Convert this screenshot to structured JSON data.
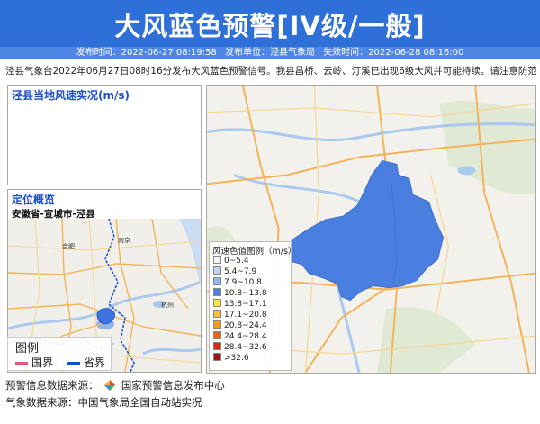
{
  "header": {
    "title": "大风蓝色预警[IV级/一般]",
    "publish_time_label": "发布时间：2022-06-27 08:19:58",
    "publisher_label": "发布单位：泾县气象局",
    "expire_time_label": "失效时间：2022-06-28 08:16:00"
  },
  "notice": "泾县气象台2022年06月27日08时16分发布大风蓝色预警信号。我县昌桥、云岭、汀溪已出现6级大风并可能持续。请注意防范！",
  "wind_panel": {
    "title": "泾县当地风速实况(m/s)"
  },
  "locate_panel": {
    "title": "定位概览",
    "location": "安徽省-宣城市-泾县",
    "map_labels": [
      "合肥",
      "南京",
      "杭州"
    ],
    "legend": {
      "title": "图例",
      "items": [
        {
          "label": "国界",
          "color": "#e05a7a"
        },
        {
          "label": "省界",
          "color": "#1a4fd0"
        }
      ]
    }
  },
  "main_map": {
    "warning_area_color": "#4a7fe0",
    "color_legend": {
      "title": "风速色值图例（m/s）",
      "rows": [
        {
          "label": "0~5.4",
          "color": "#f2f2f2"
        },
        {
          "label": "5.4~7.9",
          "color": "#bcd6f2"
        },
        {
          "label": "7.9~10.8",
          "color": "#8fbbef"
        },
        {
          "label": "10.8~13.8",
          "color": "#4a7fe0"
        },
        {
          "label": "13.8~17.1",
          "color": "#f7e93b"
        },
        {
          "label": "17.1~20.8",
          "color": "#f7c531"
        },
        {
          "label": "20.8~24.4",
          "color": "#f39a21"
        },
        {
          "label": "24.4~28.4",
          "color": "#ee5f18"
        },
        {
          "label": "28.4~32.6",
          "color": "#d62a14"
        },
        {
          "label": ">32.6",
          "color": "#9c1510"
        }
      ]
    }
  },
  "footer": {
    "warning_source_label": "预警信息数据来源：",
    "warning_source_value": "国家预警信息发布中心",
    "weather_source": "气象数据来源：中国气象局全国自动站实况"
  }
}
